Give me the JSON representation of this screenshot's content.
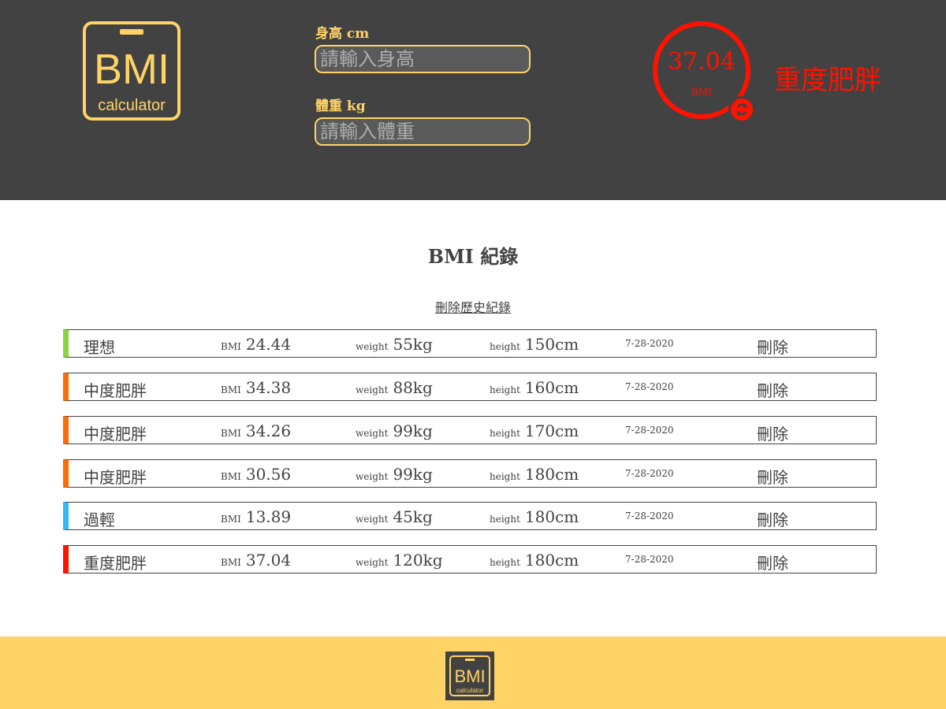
{
  "header": {
    "logo": {
      "main": "BMI",
      "sub": "calculator"
    },
    "height_field": {
      "label": "身高 cm",
      "placeholder": "請輸入身高"
    },
    "weight_field": {
      "label": "體重 kg",
      "placeholder": "請輸入體重"
    },
    "result": {
      "value": "37.04",
      "unit": "BMI",
      "status": "重度肥胖",
      "color": "#FF1200"
    }
  },
  "records_section": {
    "title": "BMI 紀錄",
    "clear_label": "刪除歷史紀錄"
  },
  "records": [
    {
      "status": "理想",
      "bmi_label": "BMI",
      "bmi": "24.44",
      "weight_label": "weight",
      "weight": "55kg",
      "height_label": "height",
      "height": "150cm",
      "date": "7-28-2020",
      "delete_label": "刪除",
      "color": "#86D73F"
    },
    {
      "status": "中度肥胖",
      "bmi_label": "BMI",
      "bmi": "34.38",
      "weight_label": "weight",
      "weight": "88kg",
      "height_label": "height",
      "height": "160cm",
      "date": "7-28-2020",
      "delete_label": "刪除",
      "color": "#FF6C03"
    },
    {
      "status": "中度肥胖",
      "bmi_label": "BMI",
      "bmi": "34.26",
      "weight_label": "weight",
      "weight": "99kg",
      "height_label": "height",
      "height": "170cm",
      "date": "7-28-2020",
      "delete_label": "刪除",
      "color": "#FF6C03"
    },
    {
      "status": "中度肥胖",
      "bmi_label": "BMI",
      "bmi": "30.56",
      "weight_label": "weight",
      "weight": "99kg",
      "height_label": "height",
      "height": "180cm",
      "date": "7-28-2020",
      "delete_label": "刪除",
      "color": "#FF6C03"
    },
    {
      "status": "過輕",
      "bmi_label": "BMI",
      "bmi": "13.89",
      "weight_label": "weight",
      "weight": "45kg",
      "height_label": "height",
      "height": "180cm",
      "date": "7-28-2020",
      "delete_label": "刪除",
      "color": "#31BAF9"
    },
    {
      "status": "重度肥胖",
      "bmi_label": "BMI",
      "bmi": "37.04",
      "weight_label": "weight",
      "weight": "120kg",
      "height_label": "height",
      "height": "180cm",
      "date": "7-28-2020",
      "delete_label": "刪除",
      "color": "#FF1200"
    }
  ],
  "footer": {
    "logo": {
      "main": "BMI",
      "sub": "calculator"
    }
  },
  "colors": {
    "background_dark": "#424242",
    "accent_yellow": "#FFD366"
  },
  "icons": {
    "reset": "refresh-icon"
  }
}
